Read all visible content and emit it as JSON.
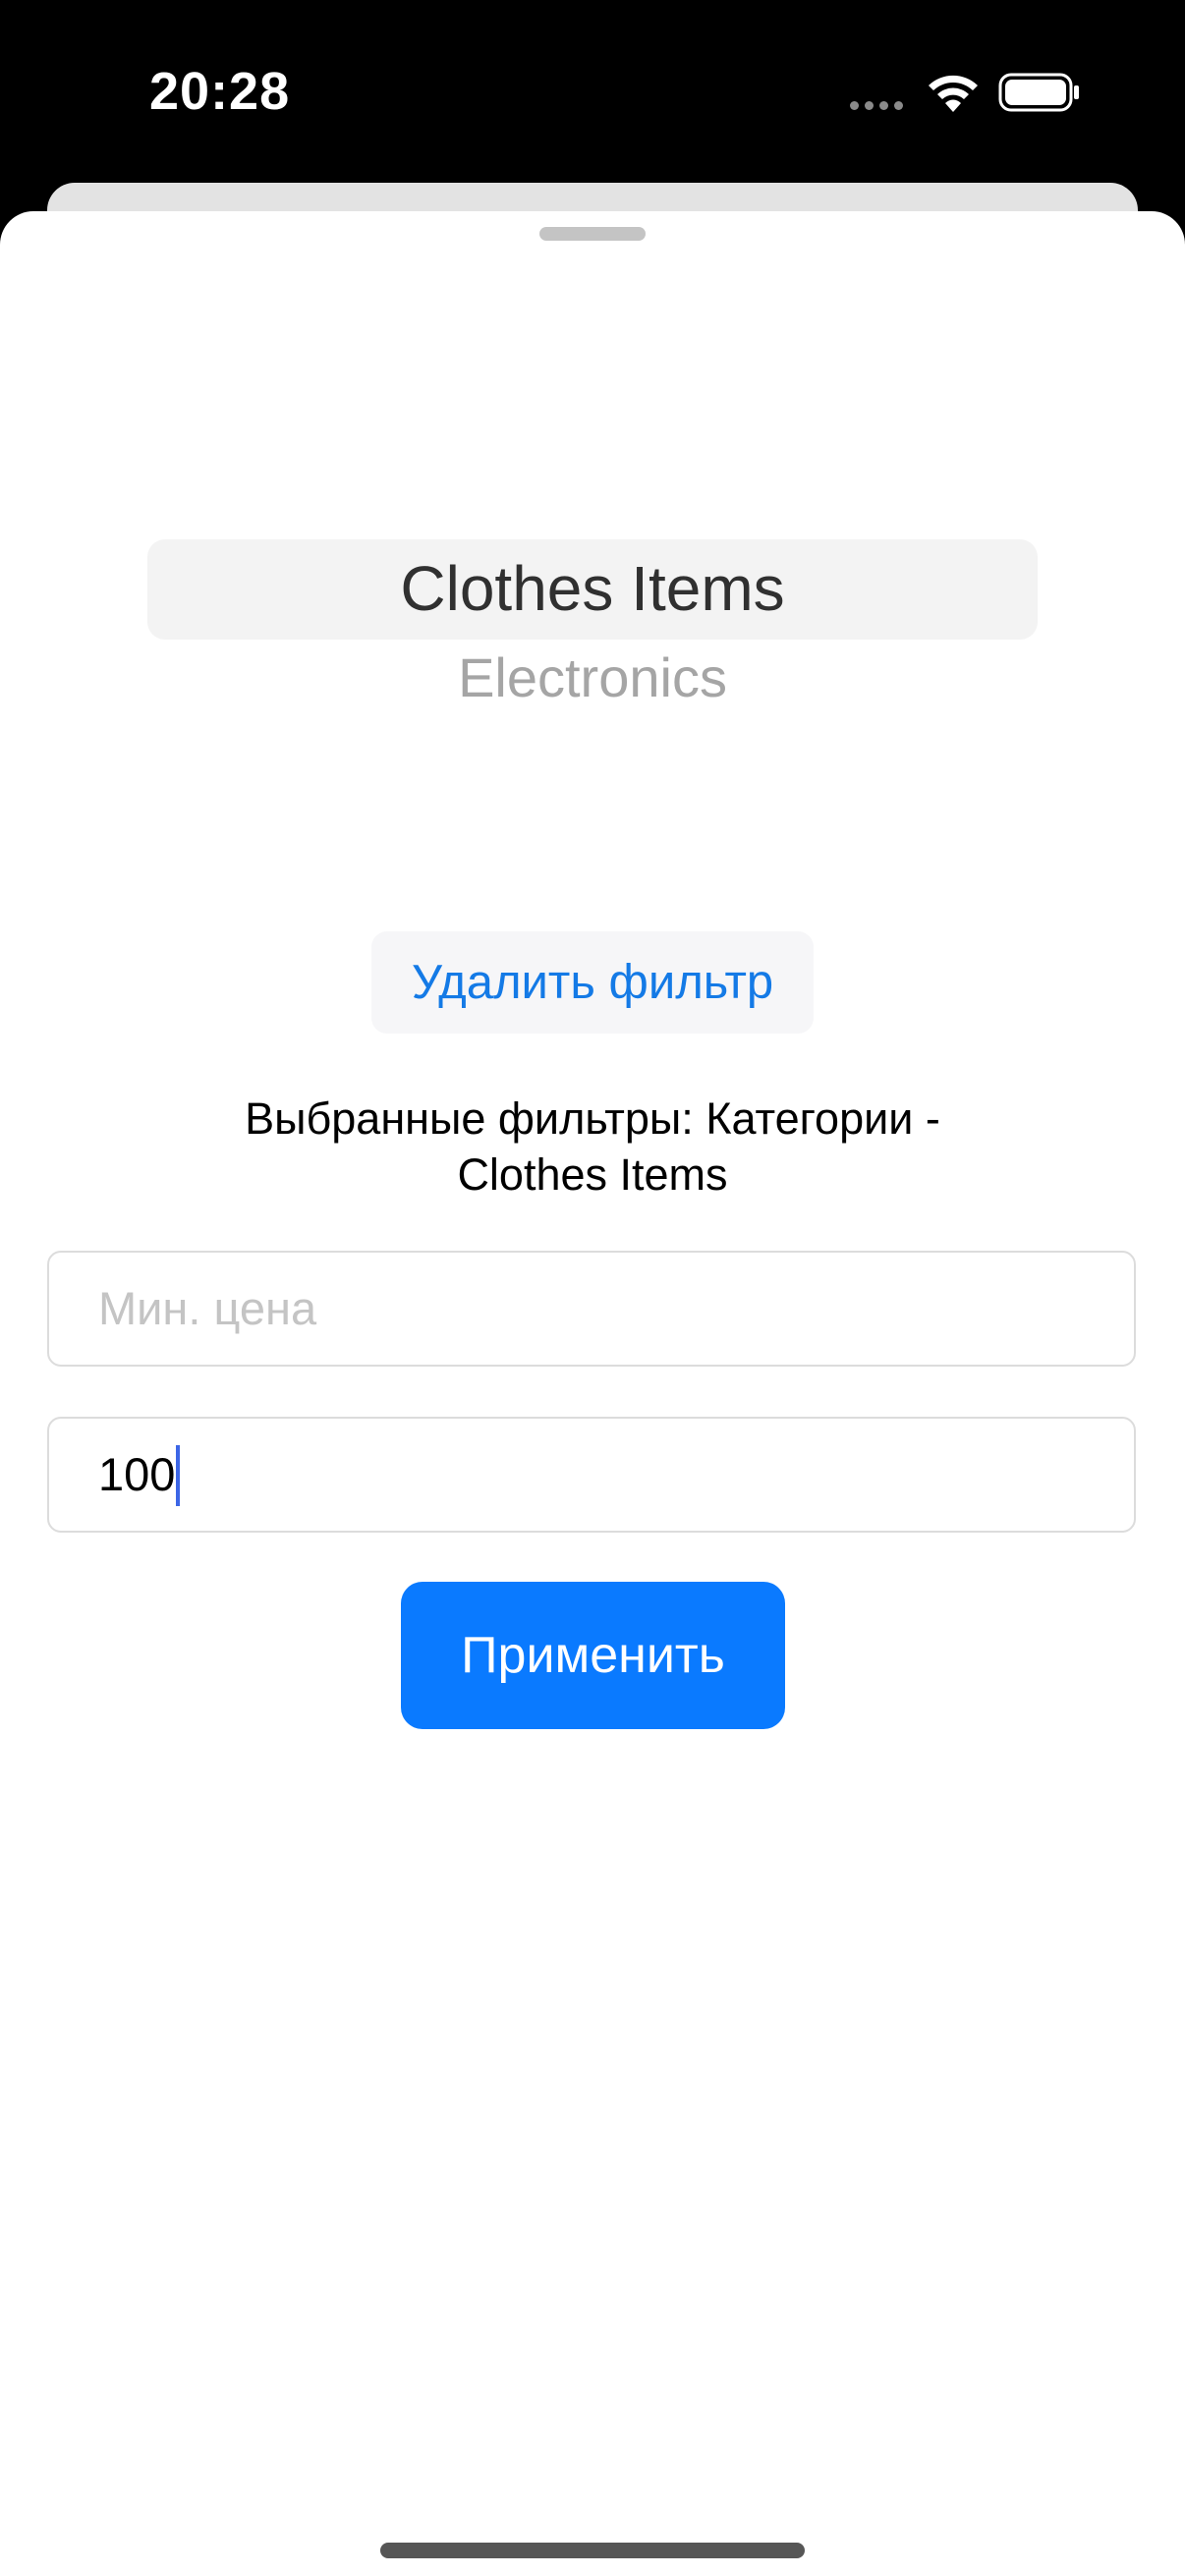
{
  "status_bar": {
    "time": "20:28",
    "wifi_icon": "wifi-icon",
    "battery_icon": "battery-icon"
  },
  "picker": {
    "selected": "Clothes Items",
    "options": [
      "Clothes Items",
      "Electronics"
    ],
    "next_option": "Electronics"
  },
  "remove_filter": {
    "label": "Удалить фильтр"
  },
  "selected_filters": {
    "line1": "Выбранные фильтры: Категории -",
    "line2": "Clothes Items"
  },
  "min_price": {
    "placeholder": "Мин. цена",
    "value": ""
  },
  "max_price": {
    "value": "100"
  },
  "apply": {
    "label": "Применить"
  },
  "colors": {
    "accent": "#0A7AFF",
    "link": "#147AE6",
    "caret": "#3C66E6"
  }
}
